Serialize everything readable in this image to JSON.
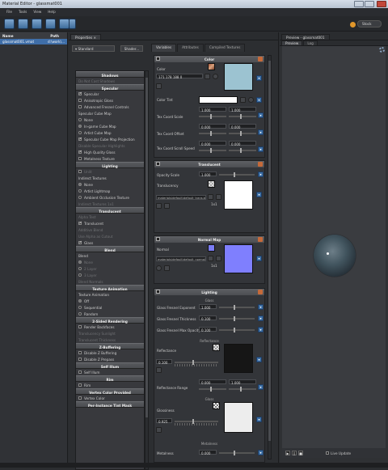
{
  "window": {
    "title": "Material Editor - glassmat001"
  },
  "menu": [
    "File",
    "Tools",
    "View",
    "Help"
  ],
  "toolbar": {
    "stock_label": "Stock"
  },
  "files_panel": {
    "col_name": "Name",
    "col_path": "Path",
    "file_name": "glassmat001.vmat",
    "file_path": "d:\\work\\..."
  },
  "properties": {
    "tab": "Properties",
    "shader_combo": "Standard",
    "shader_button": "Shader...",
    "tabs": [
      "Variables",
      "Attributes",
      "Compiled Textures"
    ],
    "left_list": [
      {
        "t": "sec",
        "label": "Shadows"
      },
      {
        "t": "row",
        "label": "Do Not Cast Shadows",
        "dim": true
      },
      {
        "t": "sec",
        "label": "Specular"
      },
      {
        "t": "cb",
        "label": "Specular",
        "on": true
      },
      {
        "t": "cb",
        "label": "Anisotropic Gloss",
        "on": false
      },
      {
        "t": "cb",
        "label": "Advanced Fresnel Controls",
        "on": false
      },
      {
        "t": "row",
        "label": "Specular Cube Map"
      },
      {
        "t": "rb",
        "label": "None",
        "on": false
      },
      {
        "t": "rb",
        "label": "In-game Cube Map",
        "on": true
      },
      {
        "t": "rb",
        "label": "Artist Cube Map",
        "on": false
      },
      {
        "t": "cb",
        "label": "Specular Cube Map Projection",
        "on": true
      },
      {
        "t": "row",
        "label": "Disable Specular Highlights",
        "dim": true
      },
      {
        "t": "cb",
        "label": "High Quality Gloss",
        "on": true
      },
      {
        "t": "cb",
        "label": "Metalness Texture",
        "on": false
      },
      {
        "t": "sec",
        "label": "Lighting"
      },
      {
        "t": "cb",
        "label": "Unlit",
        "on": false,
        "dim": true
      },
      {
        "t": "row",
        "label": "Indirect Textures"
      },
      {
        "t": "rb",
        "label": "None",
        "on": true
      },
      {
        "t": "rb",
        "label": "Artist Lightmap",
        "on": false
      },
      {
        "t": "rb",
        "label": "Ambient Occlusion Texture",
        "on": false
      },
      {
        "t": "row",
        "label": "Indirect Textures 1x1",
        "dim": true
      },
      {
        "t": "sec",
        "label": "Translucent"
      },
      {
        "t": "row",
        "label": "Alpha Test",
        "dim": true
      },
      {
        "t": "cb",
        "label": "Translucent",
        "on": true
      },
      {
        "t": "row",
        "label": "Additive Blend",
        "dim": true
      },
      {
        "t": "row",
        "label": "Use Alpha as Cutout",
        "dim": true
      },
      {
        "t": "cb",
        "label": "Glass",
        "on": true
      },
      {
        "t": "sec",
        "label": "Blend"
      },
      {
        "t": "row",
        "label": "Blend"
      },
      {
        "t": "rb",
        "label": "None",
        "on": true,
        "dim": true
      },
      {
        "t": "rb",
        "label": "2 Layer",
        "on": false,
        "dim": true
      },
      {
        "t": "rb",
        "label": "3 Layer",
        "on": false,
        "dim": true
      },
      {
        "t": "row",
        "label": "Blend Normals",
        "dim": true
      },
      {
        "t": "sec",
        "label": "Texture Animation"
      },
      {
        "t": "row",
        "label": "Texture Animation"
      },
      {
        "t": "rb",
        "label": "Off",
        "on": true
      },
      {
        "t": "rb",
        "label": "Sequential",
        "on": false
      },
      {
        "t": "rb",
        "label": "Random",
        "on": false
      },
      {
        "t": "sec",
        "label": "2-Sided Rendering"
      },
      {
        "t": "cb",
        "label": "Render Backfaces",
        "on": false
      },
      {
        "t": "row",
        "label": "Translucency Sunlight",
        "dim": true
      },
      {
        "t": "row",
        "label": "Translucent Thickness",
        "dim": true
      },
      {
        "t": "sec",
        "label": "Z-Buffering"
      },
      {
        "t": "cb",
        "label": "Disable Z Buffering",
        "on": false
      },
      {
        "t": "cb",
        "label": "Disable Z Prepass",
        "on": false
      },
      {
        "t": "sec",
        "label": "Self Illum"
      },
      {
        "t": "cb",
        "label": "Self Illum",
        "on": false
      },
      {
        "t": "sec",
        "label": "Rim"
      },
      {
        "t": "cb",
        "label": "Rim",
        "on": false
      },
      {
        "t": "sec",
        "label": "Vertex Color Provided"
      },
      {
        "t": "cb",
        "label": "Vertex Color",
        "on": false
      },
      {
        "t": "sec",
        "label": "Per-Instance Tint Mask"
      }
    ],
    "color": {
      "header": "Color",
      "label": "Color",
      "rgb": "171 178 188 0",
      "tint_label": "Color Tint",
      "texcoord_scale": "Tex Coord Scale",
      "texcoord_offset": "Tex Coord Offset",
      "texcoord_scroll": "Tex Coord Scroll Speed",
      "scale_x": "1.000",
      "scale_y": "1.000",
      "offset_x": "0.000",
      "offset_y": "0.000",
      "scroll_x": "0.000",
      "scroll_y": "0.000",
      "swatch": "#9cc3d1",
      "tint": "#ffffff"
    },
    "translucent": {
      "header": "Translucent",
      "opacity_label": "Opacity Scale",
      "opacity": "1.000",
      "translucency_label": "Translucency",
      "path": "materials\\default\\default_trans.tga",
      "size": "1x1"
    },
    "normal": {
      "header": "Normal Map",
      "label": "Normal",
      "path": "materials\\default\\default_normal.tga",
      "size": "1x1"
    },
    "lighting": {
      "header": "Lighting",
      "glass_hdr": "Glass",
      "fresnel_exp_label": "Glass Fresnel Exponent",
      "fresnel_exp": "1.000",
      "fresnel_thick_label": "Glass Fresnel Thickness",
      "fresnel_thick": "0.100",
      "fresnel_opacity_label": "Glass Fresnel Max Opacity",
      "fresnel_opacity": "0.100",
      "refl_hdr": "Reflectance",
      "refl_label": "Reflectance",
      "refl_value": "0.100",
      "refl_range_label": "Reflectance Range",
      "refl_range_min": "0.000",
      "refl_range_max": "1.000",
      "gloss_hdr": "Gloss",
      "gloss_label": "Glossiness",
      "gloss_value": "0.925",
      "metal_hdr": "Metalness",
      "metal_label": "Metalness",
      "metal_value": "0.000"
    }
  },
  "preview": {
    "tab": "Preview - glassmat001",
    "tabs": [
      "Preview",
      "Log"
    ],
    "live_update": "Live Update"
  }
}
